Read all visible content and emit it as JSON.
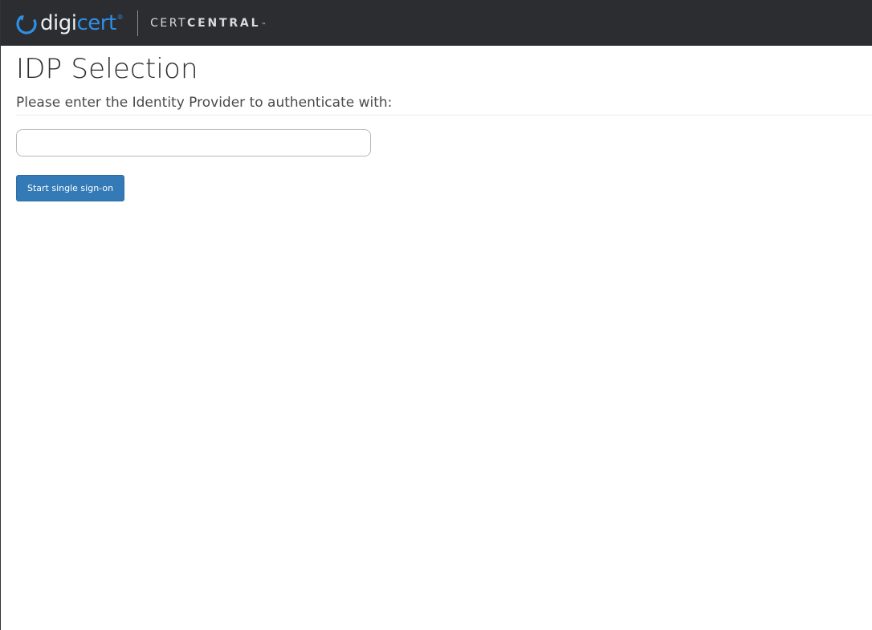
{
  "header": {
    "logo": {
      "brand_part1": "digi",
      "brand_part2": "cert",
      "registered_mark": "®",
      "icon": "digicert-logo-icon"
    },
    "product": {
      "light": "CERT",
      "bold": "CENTRAL",
      "trademark": "™"
    }
  },
  "main": {
    "title": "IDP Selection",
    "prompt": "Please enter the Identity Provider to authenticate with:",
    "idp_input": {
      "value": "",
      "placeholder": ""
    },
    "start_button_label": "Start single sign-on"
  },
  "colors": {
    "topbar_bg": "#2b2d31",
    "brand_blue": "#2f8fe6",
    "button_bg": "#337ab7",
    "button_text": "#ffffff",
    "title_text": "#2d2d2d"
  }
}
